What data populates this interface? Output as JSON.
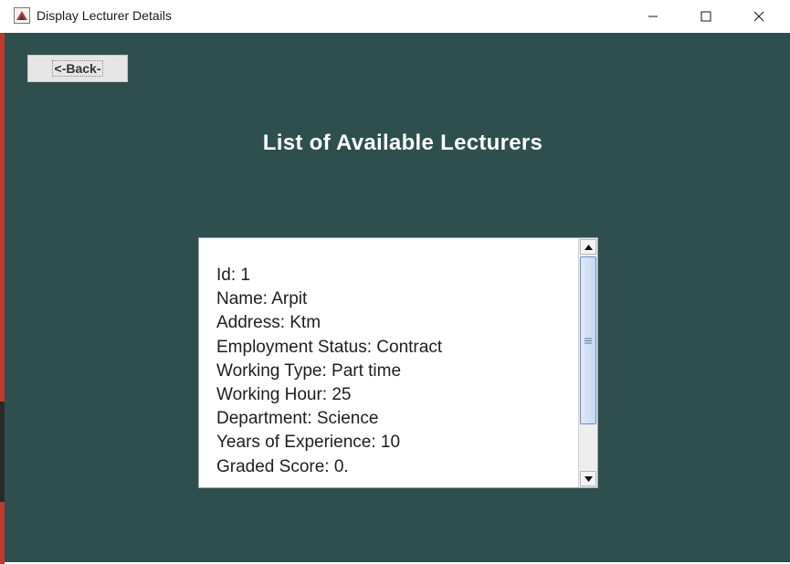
{
  "window": {
    "title": "Display Lecturer Details",
    "app_icon": "java-app-icon",
    "controls": [
      "minimize-icon",
      "maximize-icon",
      "close-icon"
    ]
  },
  "toolbar": {
    "back_label": "<-Back-"
  },
  "heading": "List of Available Lecturers",
  "lecturer_details": {
    "id": "Id: 1",
    "name": "Name: Arpit",
    "address": "Address: Ktm",
    "employment_status": "Employment Status: Contract",
    "working_type": "Working Type: Part time",
    "working_hour": "Working Hour: 25",
    "department": "Department: Science",
    "years_of_experience": "Years of Experience: 10",
    "graded_score": "Graded Score: 0."
  },
  "colors": {
    "content_background": "#2f4f4f",
    "heading_text": "#ffffff",
    "scroll_thumb_border": "#6b8cc4"
  }
}
